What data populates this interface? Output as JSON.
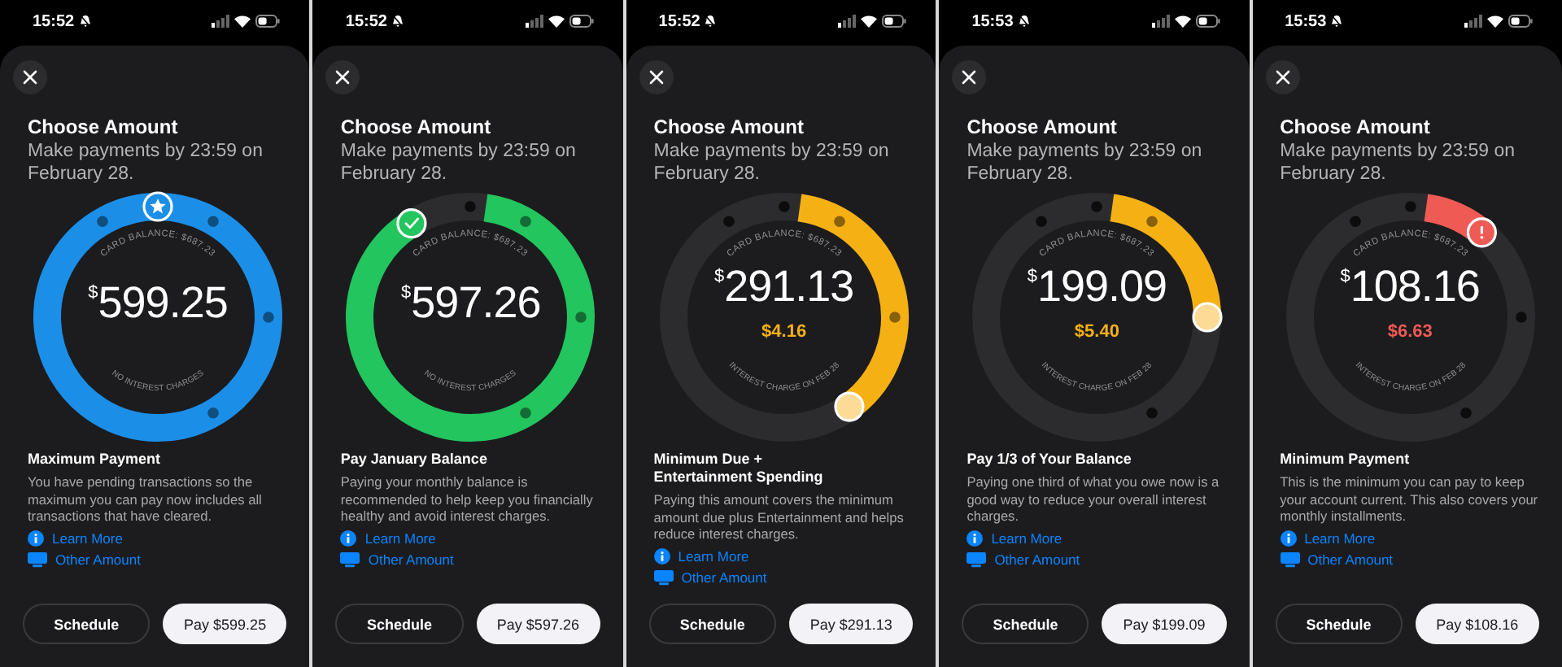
{
  "screens": [
    {
      "status_bar": {
        "time": "15:52"
      },
      "kind": "maximum",
      "color": "#1b8fe8",
      "title": "Choose Amount",
      "subtitle": "Make payments by 23:59 on February 28.",
      "gauge": {
        "top_label": "CARD BALANCE: $687.23",
        "currency": "$",
        "amount": "599.25",
        "bottom_label": "NO INTEREST CHARGES"
      },
      "heading": "Maximum Payment",
      "description": "You have pending transactions so the maximum you can pay now includes all transactions that have cleared.",
      "links": [
        {
          "kind": "info",
          "label": "Learn More"
        },
        {
          "kind": "card",
          "label": "Other Amount"
        }
      ],
      "buttons": [
        {
          "label": "Schedule",
          "primary": false
        },
        {
          "label": "Pay $599.25",
          "primary": true
        }
      ]
    },
    {
      "status_bar": {
        "time": "15:52"
      },
      "kind": "statement",
      "color": "#22c55e",
      "title": "Choose Amount",
      "subtitle": "Make payments by 23:59 on February 28.",
      "gauge": {
        "top_label": "CARD BALANCE: $687.23",
        "currency": "$",
        "amount": "597.26",
        "bottom_label": "NO INTEREST CHARGES"
      },
      "heading": "Pay January Balance",
      "description": "Paying your monthly balance is recommended to help keep you financially healthy and avoid interest charges.",
      "links": [
        {
          "kind": "info",
          "label": "Learn More"
        },
        {
          "kind": "card",
          "label": "Other Amount"
        }
      ],
      "buttons": [
        {
          "label": "Schedule",
          "primary": false
        },
        {
          "label": "Pay $597.26",
          "primary": true
        }
      ]
    },
    {
      "status_bar": {
        "time": "15:52"
      },
      "kind": "custom",
      "color": "#f5b014",
      "title": "Choose Amount",
      "subtitle": "Make payments by 23:59 on February 28.",
      "gauge": {
        "top_label": "CARD BALANCE: $687.23",
        "currency": "$",
        "amount": "291.13",
        "interest": "$4.16",
        "bottom_label": "INTEREST CHARGE ON FEB 28"
      },
      "heading": "Minimum Due + Entertainment Spending",
      "description": "Paying this amount covers the minimum amount due plus Entertainment and helps reduce interest charges.",
      "links": [
        {
          "kind": "info",
          "label": "Learn More"
        },
        {
          "kind": "card",
          "label": "Other Amount"
        }
      ],
      "buttons": [
        {
          "label": "Schedule",
          "primary": false
        },
        {
          "label": "Pay $291.13",
          "primary": true
        }
      ]
    },
    {
      "status_bar": {
        "time": "15:53"
      },
      "kind": "custom",
      "color": "#f5b014",
      "title": "Choose Amount",
      "subtitle": "Make payments by 23:59 on February 28.",
      "gauge": {
        "top_label": "CARD BALANCE: $687.23",
        "currency": "$",
        "amount": "199.09",
        "interest": "$5.40",
        "bottom_label": "INTEREST CHARGE ON FEB 28"
      },
      "heading": "Pay 1/3 of Your Balance",
      "description": "Paying one third of what you owe now is a good way to reduce your overall interest charges.",
      "links": [
        {
          "kind": "info",
          "label": "Learn More"
        },
        {
          "kind": "card",
          "label": "Other Amount"
        }
      ],
      "buttons": [
        {
          "label": "Schedule",
          "primary": false
        },
        {
          "label": "Pay $199.09",
          "primary": true
        }
      ]
    },
    {
      "status_bar": {
        "time": "15:53"
      },
      "kind": "minimum",
      "color": "#ef5a55",
      "title": "Choose Amount",
      "subtitle": "Make payments by 23:59 on February 28.",
      "gauge": {
        "top_label": "CARD BALANCE: $687.23",
        "currency": "$",
        "amount": "108.16",
        "interest": "$6.63",
        "bottom_label": "INTEREST CHARGE ON FEB 28"
      },
      "heading": "Minimum Payment",
      "description": "This is the minimum you can pay to keep your account current. This also covers your monthly installments.",
      "links": [
        {
          "kind": "info",
          "label": "Learn More"
        },
        {
          "kind": "card",
          "label": "Other Amount"
        }
      ],
      "buttons": [
        {
          "label": "Schedule",
          "primary": false
        },
        {
          "label": "Pay $108.16",
          "primary": true
        }
      ]
    }
  ]
}
